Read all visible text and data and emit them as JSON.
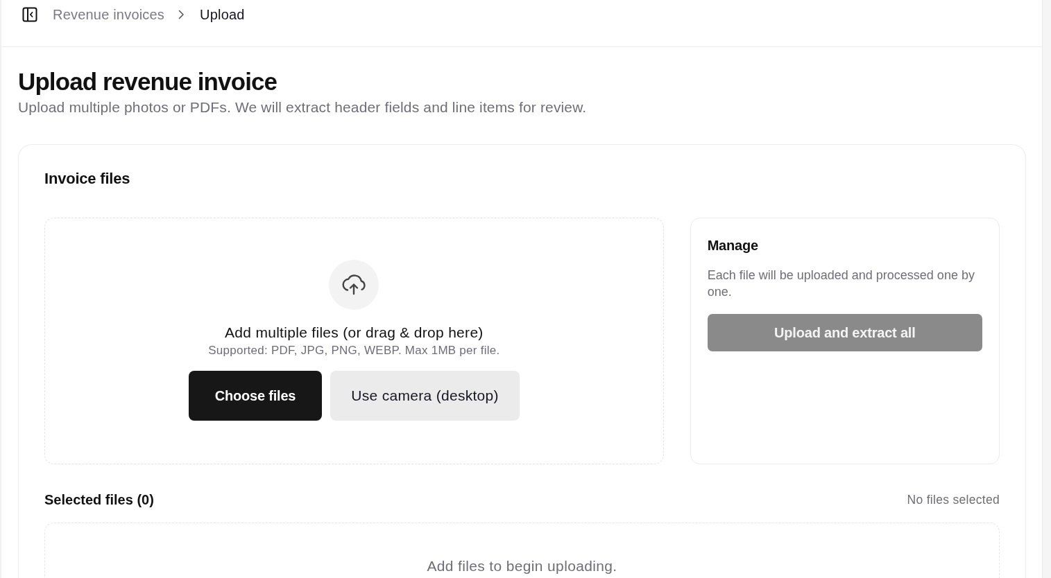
{
  "header": {
    "breadcrumbs": [
      {
        "label": "Revenue invoices",
        "current": false
      },
      {
        "label": "Upload",
        "current": true
      }
    ]
  },
  "page": {
    "title": "Upload revenue invoice",
    "subtitle": "Upload multiple photos or PDFs. We will extract header fields and line items for review."
  },
  "invoice_files": {
    "title": "Invoice files",
    "dropzone": {
      "heading": "Add multiple files (or drag & drop here)",
      "hint": "Supported: PDF, JPG, PNG, WEBP. Max 1MB per file.",
      "buttons": [
        {
          "label": "Choose files",
          "kind": "primary"
        },
        {
          "label": "Use camera (desktop)",
          "kind": "secondary"
        }
      ]
    },
    "manage": {
      "title": "Manage",
      "description": "Each file will be uploaded and processed one by one.",
      "button": {
        "label": "Upload and extract all",
        "disabled": true
      }
    },
    "selected": {
      "title": "Selected files (0)",
      "status": "No files selected",
      "empty_message": "Add files to begin uploading."
    }
  }
}
